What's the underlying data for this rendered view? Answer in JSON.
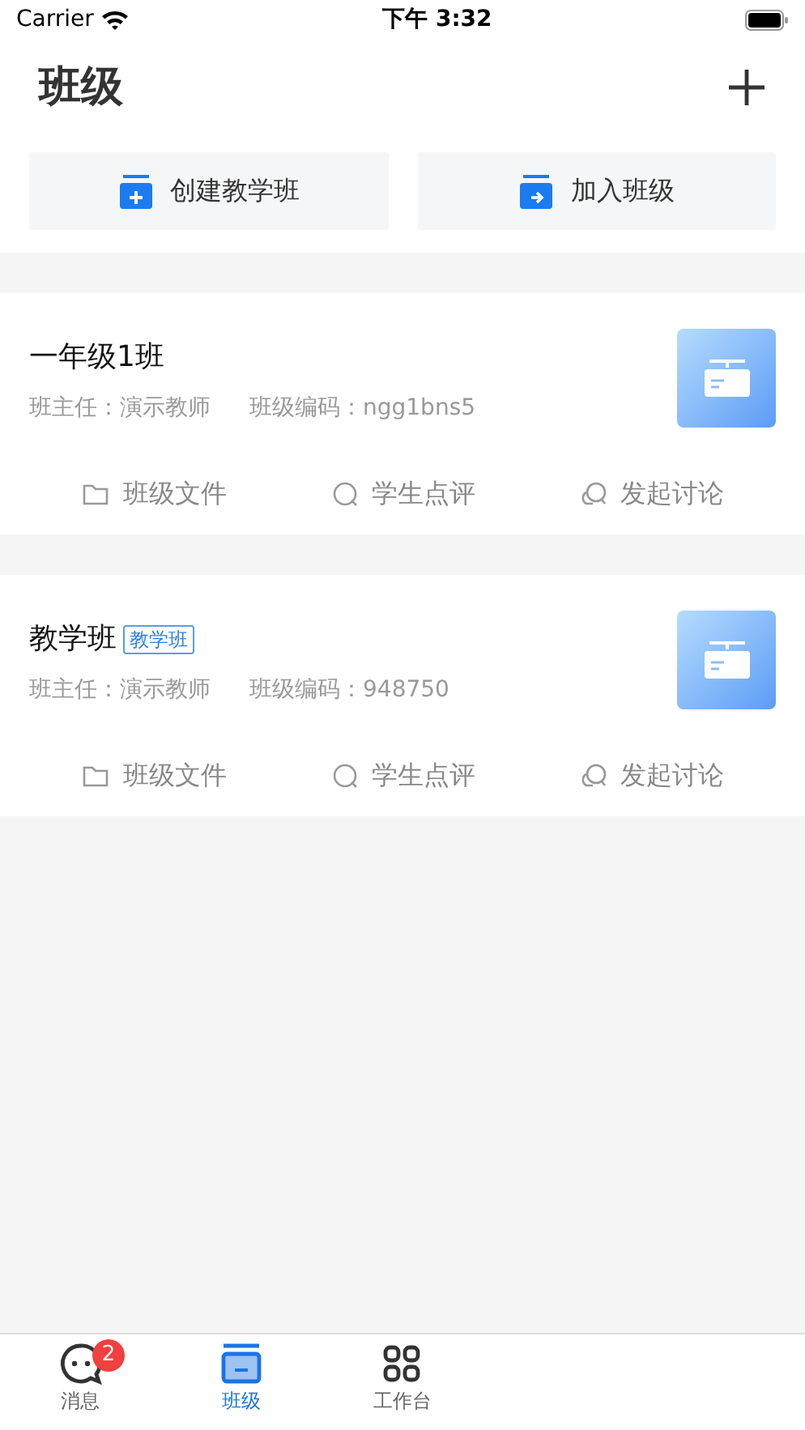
{
  "status_bar": {
    "carrier": "Carrier",
    "time": "下午 3:32"
  },
  "header": {
    "title": "班级"
  },
  "quick_actions": [
    {
      "kind": "create",
      "label": "创建教学班"
    },
    {
      "kind": "join",
      "label": "加入班级"
    }
  ],
  "classes": [
    {
      "name": "一年级1班",
      "teacher": "班主任：演示教师",
      "code": "班级编码：ngg1bns5",
      "actions": [
        {
          "kind": "files",
          "label": "班级文件"
        },
        {
          "kind": "review",
          "label": "学生点评"
        },
        {
          "kind": "discuss",
          "label": "发起讨论"
        }
      ]
    },
    {
      "name": "教学班",
      "tag": "教学班",
      "teacher": "班主任：演示教师",
      "code": "班级编码：948750",
      "actions": [
        {
          "kind": "files",
          "label": "班级文件"
        },
        {
          "kind": "review",
          "label": "学生点评"
        },
        {
          "kind": "discuss",
          "label": "发起讨论"
        }
      ]
    }
  ],
  "tab_bar": [
    {
      "kind": "messages",
      "label": "消息",
      "selected": false,
      "badge": "2"
    },
    {
      "kind": "classes",
      "label": "班级",
      "selected": true
    },
    {
      "kind": "workbench",
      "label": "工作台",
      "selected": false
    }
  ]
}
